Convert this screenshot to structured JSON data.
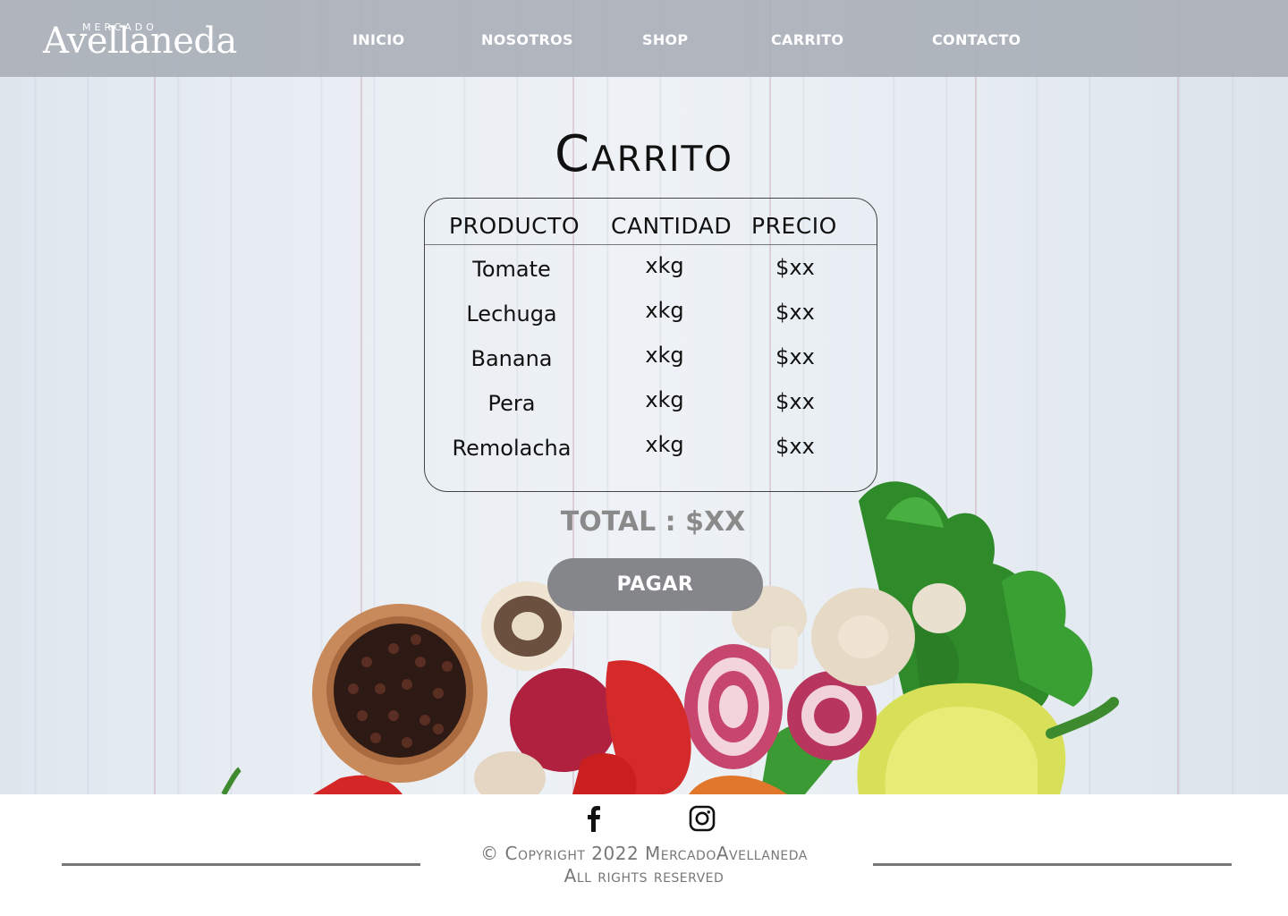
{
  "brand": {
    "small": "MERCADO",
    "name": "Avellaneda"
  },
  "nav": [
    {
      "label": "INICIO"
    },
    {
      "label": "NOSOTROS"
    },
    {
      "label": "SHOP"
    },
    {
      "label": "CARRITO"
    },
    {
      "label": "CONTACTO"
    }
  ],
  "cart": {
    "title": "Carrito",
    "columns": [
      "PRODUCTO",
      "CANTIDAD",
      "PRECIO"
    ],
    "rows": [
      {
        "product": "Tomate",
        "quantity": "xkg",
        "price": "$xx"
      },
      {
        "product": "Lechuga",
        "quantity": "xkg",
        "price": "$xx"
      },
      {
        "product": "Banana",
        "quantity": "xkg",
        "price": "$xx"
      },
      {
        "product": "Pera",
        "quantity": "xkg",
        "price": "$xx"
      },
      {
        "product": "Remolacha",
        "quantity": "xkg",
        "price": "$xx"
      }
    ],
    "total": "TOTAL : $XX",
    "pay_label": "PAGAR"
  },
  "footer": {
    "social": [
      {
        "icon": "facebook-icon"
      },
      {
        "icon": "instagram-icon"
      }
    ],
    "copyright": "© Copyright 2022 MercadoAvellaneda",
    "rights": "All rights reserved"
  },
  "colors": {
    "header_bg": "#aab0b8",
    "button_bg": "#858689",
    "total_text": "#8a8a8a",
    "footer_line": "#777777"
  }
}
